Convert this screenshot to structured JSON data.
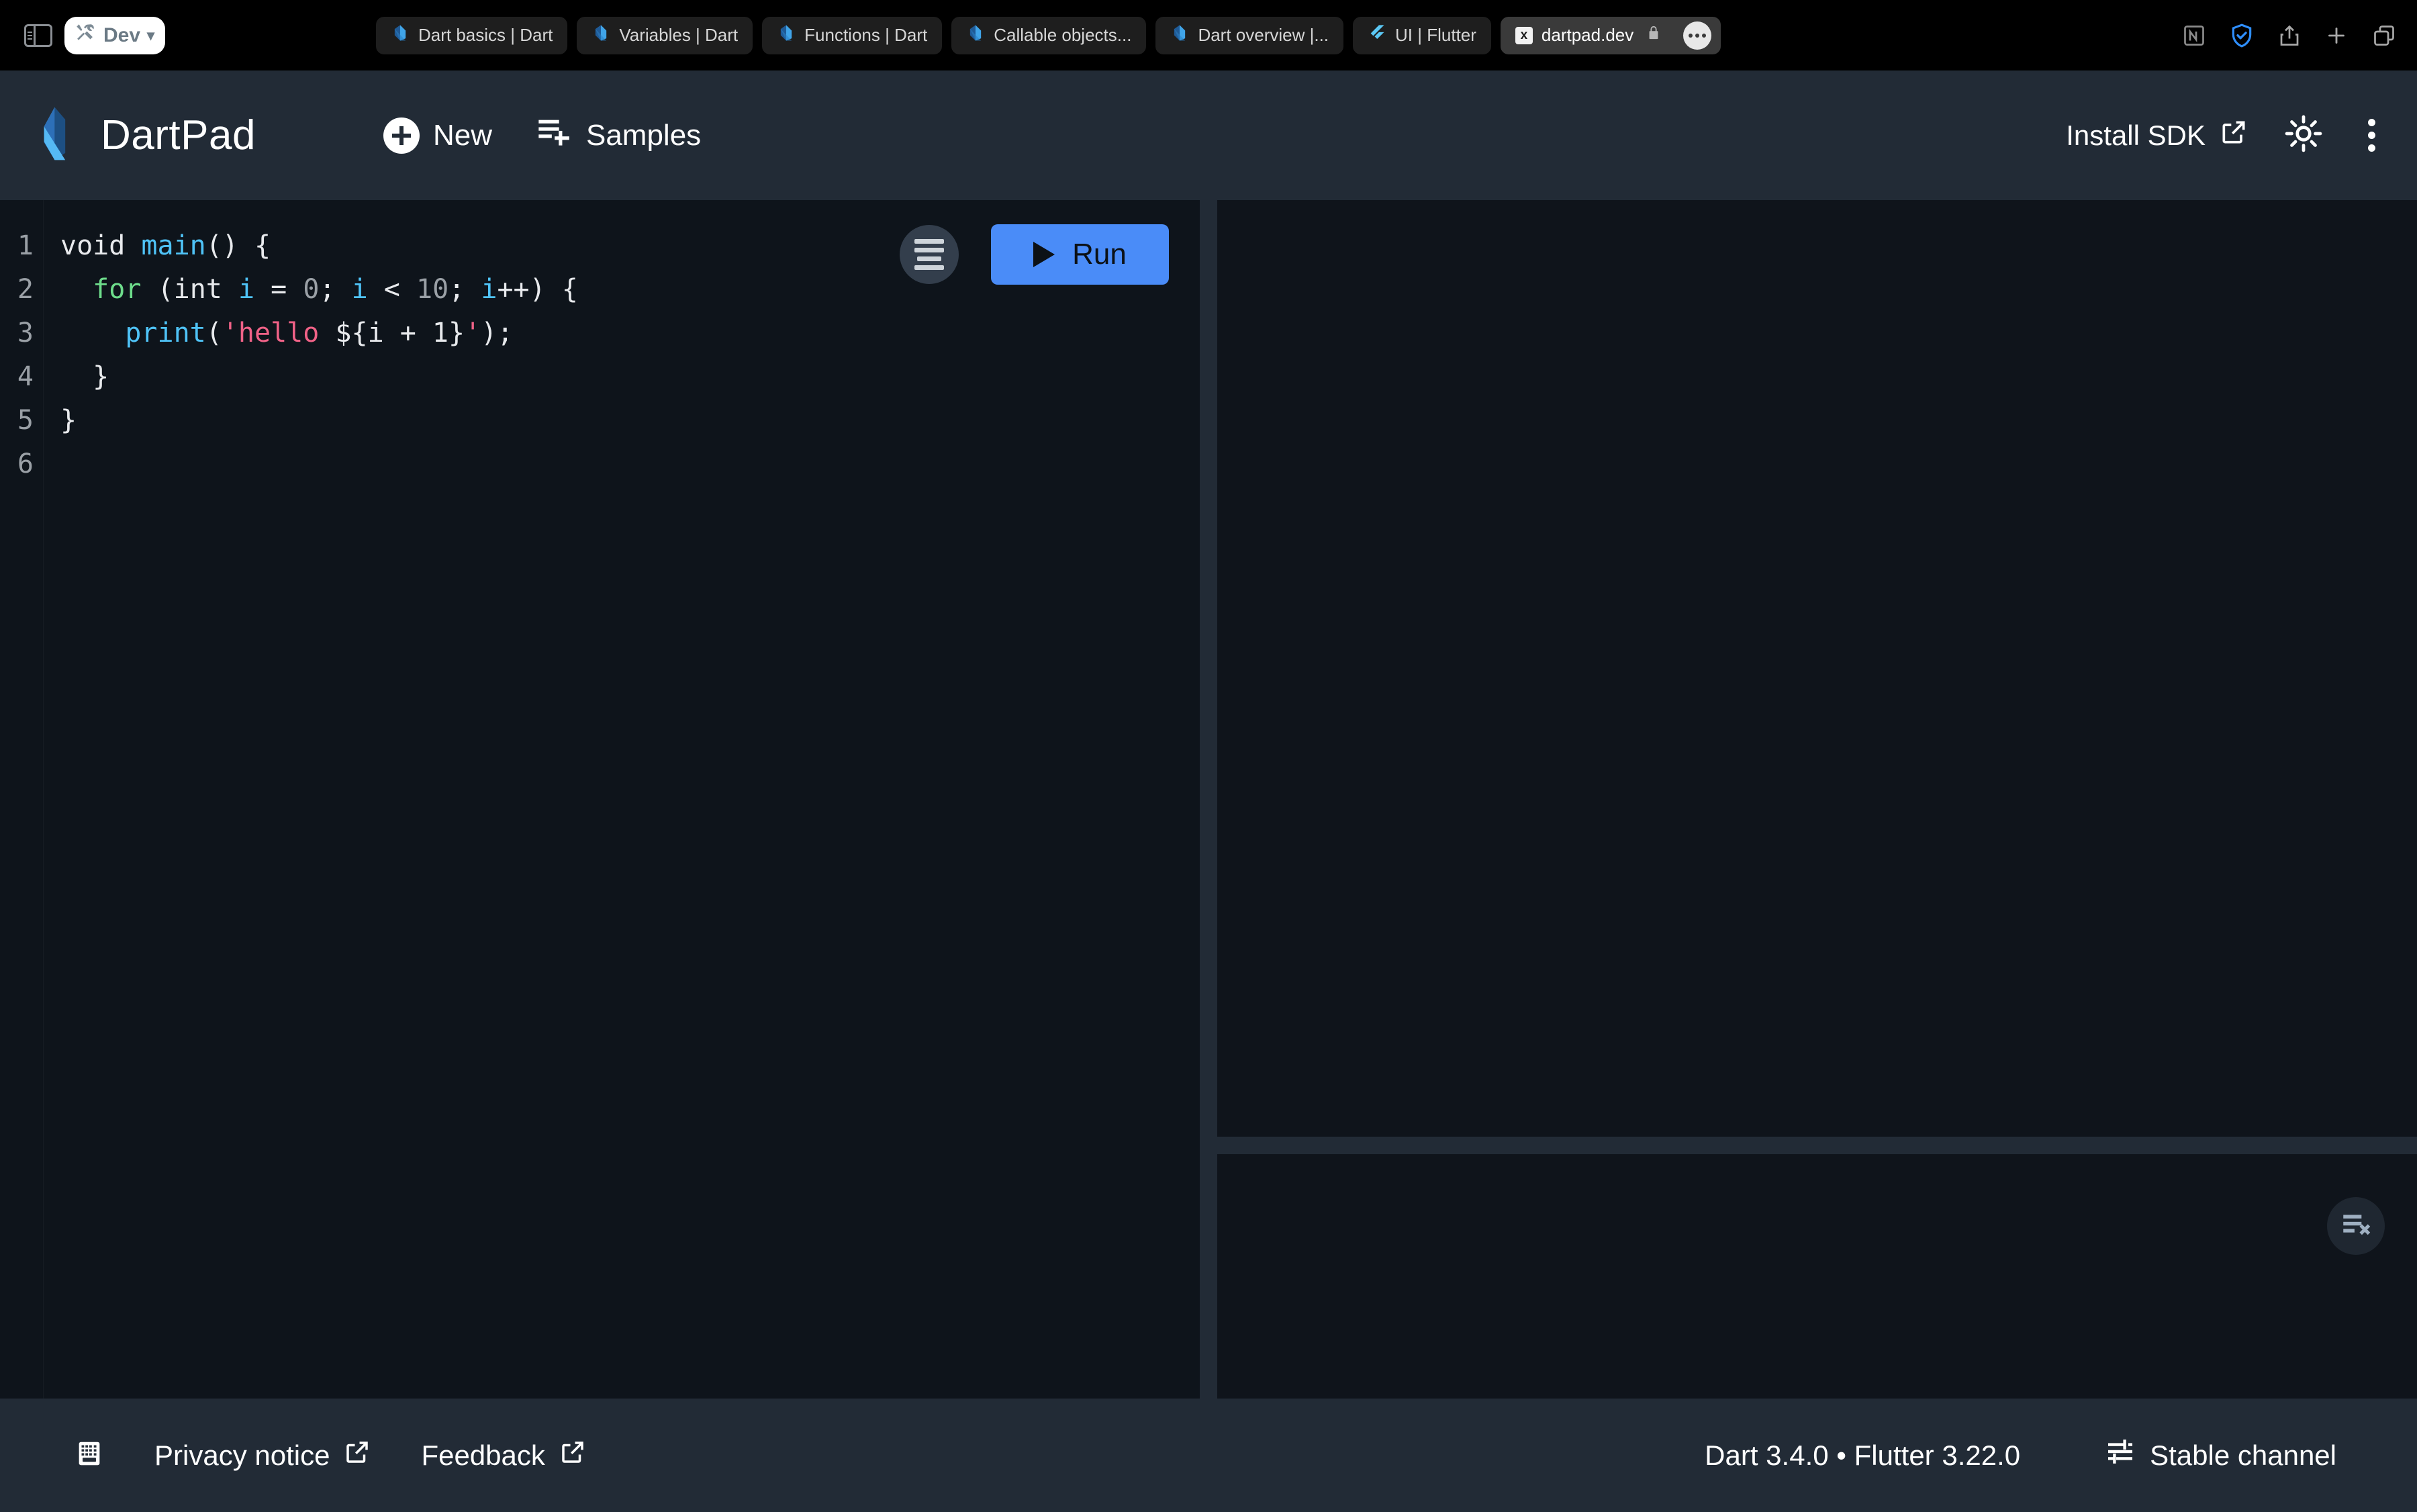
{
  "browser": {
    "sidebar_toggle_icon": "sidebar-toggle-icon",
    "profile": {
      "label": "Dev",
      "icon": "tools-icon",
      "chevron": "chevron-down-icon"
    },
    "tabs": [
      {
        "title": "Dart basics | Dart",
        "favicon": "dart-logo-icon",
        "active": false
      },
      {
        "title": "Variables | Dart",
        "favicon": "dart-logo-icon",
        "active": false
      },
      {
        "title": "Functions | Dart",
        "favicon": "dart-logo-icon",
        "active": false
      },
      {
        "title": "Callable objects...",
        "favicon": "dart-logo-icon",
        "active": false
      },
      {
        "title": "Dart overview |...",
        "favicon": "dart-logo-icon",
        "active": false
      },
      {
        "title": "UI | Flutter",
        "favicon": "flutter-logo-icon",
        "active": false
      },
      {
        "title": "dartpad.dev",
        "favicon": "x-favicon-icon",
        "active": true,
        "secure": true
      }
    ],
    "toolbar_icons": [
      "notion-icon",
      "adguard-shield-icon",
      "share-icon",
      "new-tab-plus-icon",
      "tab-overview-icon"
    ]
  },
  "header": {
    "logo_icon": "dartpad-logo-icon",
    "title": "DartPad",
    "new_label": "New",
    "new_icon": "plus-circle-icon",
    "samples_label": "Samples",
    "samples_icon": "playlist-add-icon",
    "install_sdk_label": "Install SDK",
    "install_sdk_icon": "open-in-new-icon",
    "theme_icon": "brightness-sun-icon",
    "menu_icon": "more-vert-icon"
  },
  "editor": {
    "format_icon": "format-align-left-icon",
    "run_label": "Run",
    "run_icon": "play-arrow-icon",
    "line_numbers": [
      "1",
      "2",
      "3",
      "4",
      "5",
      "6"
    ],
    "code_lines": [
      "void main() {",
      "  for (int i = 0; i < 10; i++) {",
      "    print('hello ${i + 1}');",
      "  }",
      "}",
      ""
    ]
  },
  "output": {
    "content": ""
  },
  "console": {
    "content": "",
    "clear_icon": "clear-console-icon"
  },
  "statusbar": {
    "keyboard_icon": "keyboard-shortcuts-icon",
    "privacy_label": "Privacy notice",
    "privacy_icon": "open-in-new-icon",
    "feedback_label": "Feedback",
    "feedback_icon": "open-in-new-icon",
    "version": "Dart 3.4.0 • Flutter 3.22.0",
    "channel_label": "Stable channel",
    "channel_icon": "tune-icon"
  },
  "colors": {
    "chrome_bg": "#000000",
    "header_bg": "#222b36",
    "editor_bg": "#0e141b",
    "pane_bg": "#0f141b",
    "accent_run": "#4a8cf8",
    "dart_blue": "#40a4e8",
    "flutter_blue": "#5bc8f5",
    "code_keyword": "#e8eaed",
    "code_function": "#4fc3f7",
    "code_control": "#6ddc8b",
    "code_number": "#9aa0a6",
    "code_string": "#f06287"
  }
}
